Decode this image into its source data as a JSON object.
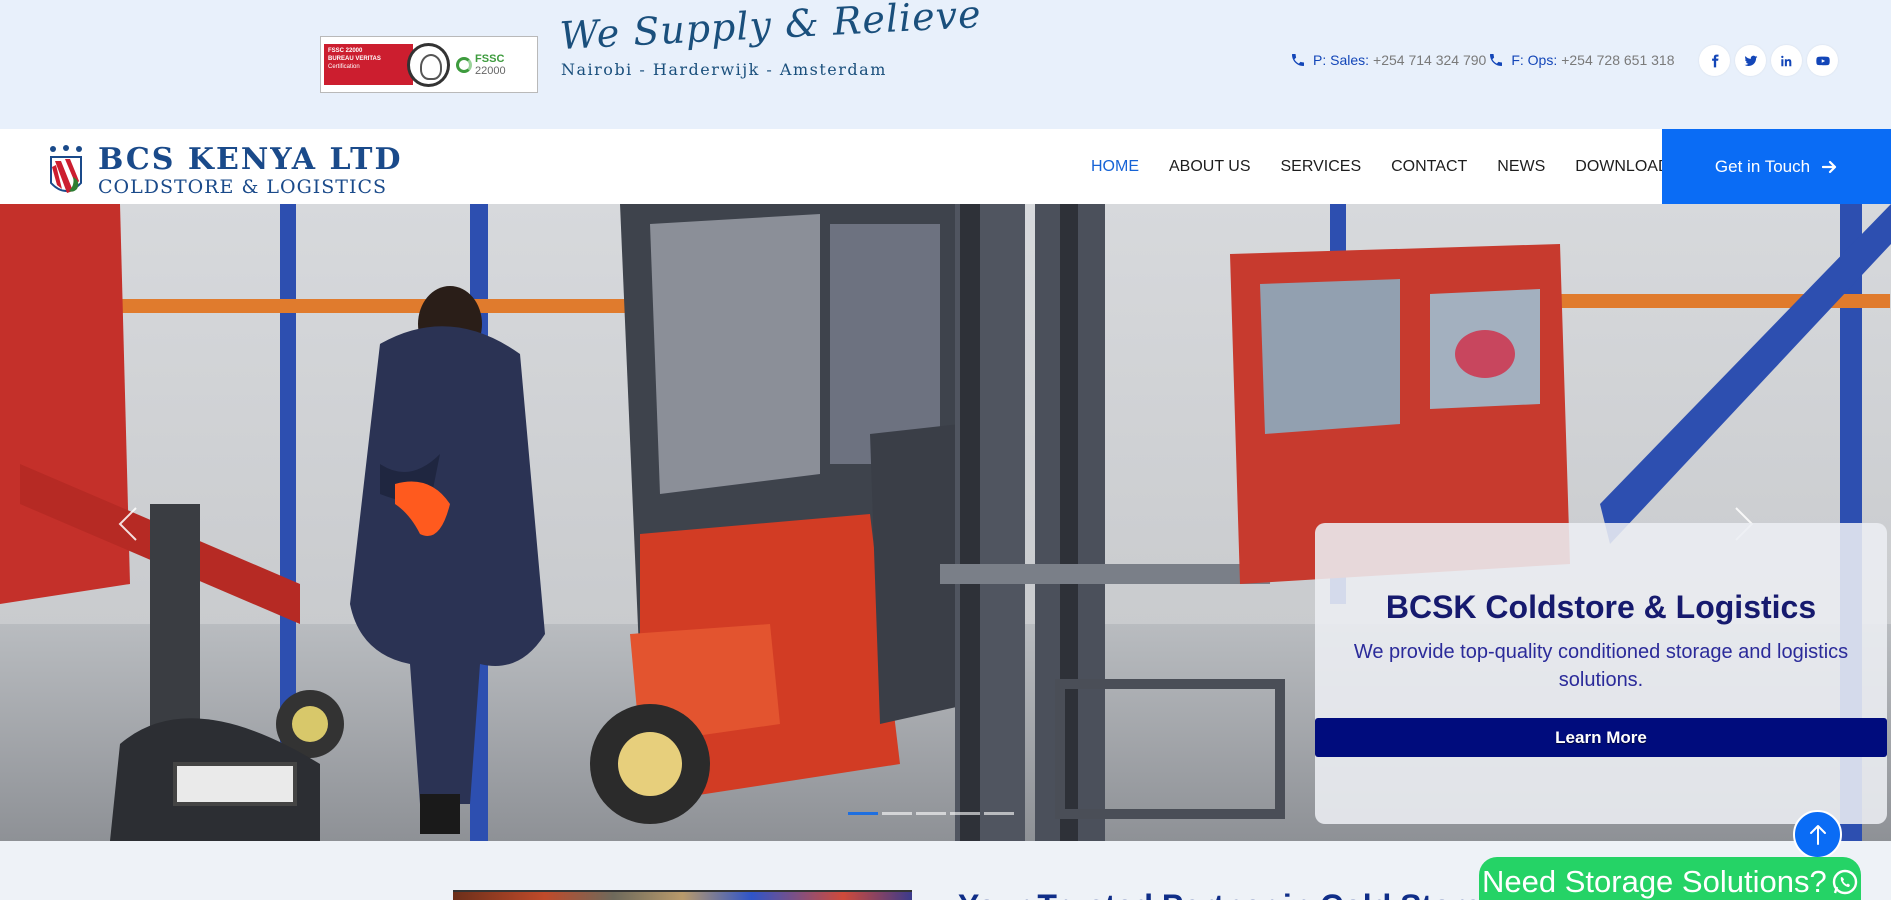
{
  "topbar": {
    "certifications": {
      "bureau_veritas_lines": [
        "FSSC 22000",
        "BUREAU VERITAS",
        "Certification"
      ],
      "fssc_brand": "FSSC",
      "fssc_number": "22000"
    },
    "slogan": "We Supply & Relieve",
    "cities": "Nairobi - Harderwijk - Amsterdam",
    "contacts": [
      {
        "label": "P: Sales:",
        "number": "+254 714 324 790",
        "icon": "phone-icon"
      },
      {
        "label": "F: Ops:",
        "number": "+254 728 651 318",
        "icon": "phone-icon"
      }
    ],
    "socials": [
      "facebook-icon",
      "twitter-icon",
      "linkedin-icon",
      "youtube-icon"
    ]
  },
  "nav": {
    "logo_name": "BCS KENYA LTD",
    "logo_sub": "COLDSTORE & LOGISTICS",
    "items": [
      {
        "label": "HOME",
        "active": true
      },
      {
        "label": "ABOUT US",
        "active": false
      },
      {
        "label": "SERVICES",
        "active": false
      },
      {
        "label": "CONTACT",
        "active": false
      },
      {
        "label": "NEWS",
        "active": false
      },
      {
        "label": "DOWNLOADS",
        "active": false
      }
    ],
    "cta": "Get in Touch"
  },
  "hero": {
    "caption_title": "BCSK Coldstore & Logistics",
    "caption_text": "We provide top-quality conditioned storage and logistics solutions.",
    "button": "Learn More",
    "slides_total": 5,
    "active_slide": 1
  },
  "below": {
    "heading": "Your Trusted Partner in Cold Storage",
    "whatsapp": "Need Storage Solutions?"
  },
  "colors": {
    "primary": "#0a6cf5",
    "nav_active": "#1663d6",
    "caption_title": "#161a6e",
    "caption_button": "#000c7d",
    "whatsapp": "#25d366"
  }
}
